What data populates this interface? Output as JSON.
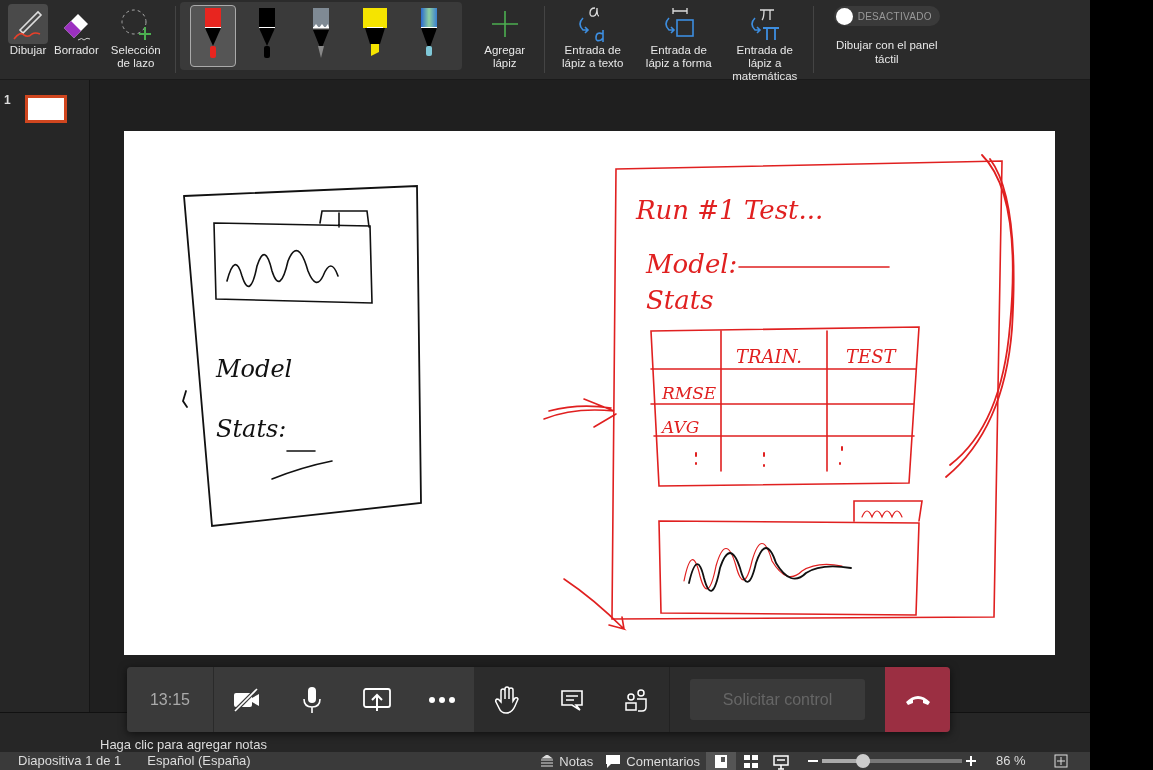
{
  "ribbon": {
    "tools": [
      {
        "label": "Dibujar",
        "selected": true,
        "kind": "draw"
      },
      {
        "label": "Borrador",
        "selected": false,
        "kind": "eraser"
      },
      {
        "label": "Selección de lazo",
        "selected": false,
        "kind": "lasso"
      }
    ],
    "pens": [
      {
        "kind": "pen",
        "color": "#e8251f",
        "selected": true
      },
      {
        "kind": "pen",
        "color": "#000000",
        "selected": false
      },
      {
        "kind": "pencil",
        "color": "#7f8a94",
        "selected": false
      },
      {
        "kind": "highlighter",
        "color": "#f5e400",
        "selected": false
      },
      {
        "kind": "galaxy",
        "color": "#4a90c8",
        "selected": false
      }
    ],
    "add_pen": "Agregar lápiz",
    "ink_tools": [
      {
        "kind": "text",
        "label": "Entrada de lápiz a texto"
      },
      {
        "kind": "shape",
        "label": "Entrada de lápiz a forma"
      },
      {
        "kind": "math",
        "label": "Entrada de lápiz a matemáticas"
      }
    ],
    "touch_toggle": {
      "state_label": "DESACTIVADO",
      "on": false,
      "label": "Dibujar con el panel táctil"
    }
  },
  "slides": [
    {
      "number": "1",
      "selected": true
    }
  ],
  "slide": {
    "handwriting": [
      {
        "text": "Model",
        "color": "#111111"
      },
      {
        "text": "Stats:",
        "color": "#111111"
      },
      {
        "text": "Run #1 Test...",
        "color": "#e02020"
      },
      {
        "text": "Model:",
        "color": "#e02020"
      },
      {
        "text": "Stats",
        "color": "#e02020"
      },
      {
        "text": "TRAIN.",
        "color": "#e02020"
      },
      {
        "text": "TEST",
        "color": "#e02020"
      },
      {
        "text": "RMSE",
        "color": "#e02020"
      },
      {
        "text": "AVG",
        "color": "#e02020"
      }
    ]
  },
  "notes": {
    "placeholder": "Haga clic para agregar notas"
  },
  "call_bar": {
    "time": "13:15",
    "camera_on": false,
    "request_control": "Solicitar control"
  },
  "status_bar": {
    "slide": "Diapositiva 1 de 1",
    "language": "Español (España)",
    "notes": "Notas",
    "comments": "Comentarios",
    "views": [
      {
        "kind": "normal",
        "selected": true
      },
      {
        "kind": "sorter",
        "selected": false
      },
      {
        "kind": "reading",
        "selected": false
      }
    ],
    "zoom": {
      "level": 0.34
    },
    "zoom_label": "86 %"
  }
}
